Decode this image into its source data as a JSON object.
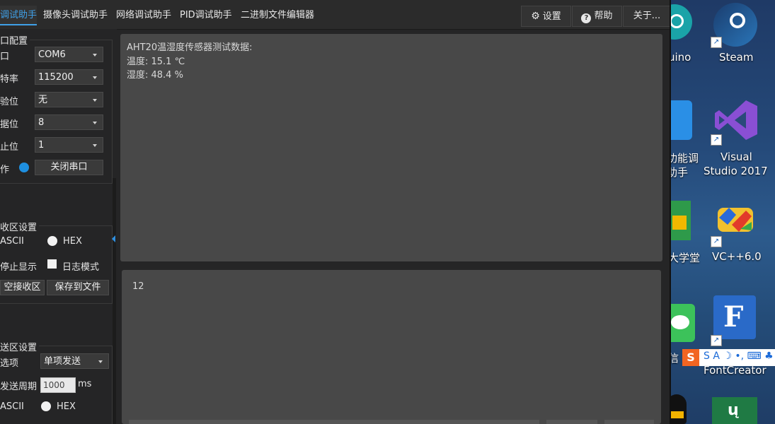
{
  "tabs": [
    "调试助手",
    "摄像头调试助手",
    "网络调试助手",
    "PID调试助手",
    "二进制文件编辑器"
  ],
  "toolbar": {
    "settings": "设置",
    "help": "帮助",
    "about": "关于..."
  },
  "serial": {
    "title": "口配置",
    "port_label": "口",
    "port_value": "COM6",
    "baud_label": "特率",
    "baud_value": "115200",
    "parity_label": "验位",
    "parity_value": "无",
    "databits_label": "据位",
    "databits_value": "8",
    "stopbits_label": "止位",
    "stopbits_value": "1",
    "op_label": "作",
    "close_button": "关闭串口"
  },
  "receive": {
    "title": "收区设置",
    "ascii": "ASCII",
    "hex": "HEX",
    "pause": "停止显示",
    "log_mode": "日志模式",
    "clear": "空接收区",
    "save": "保存到文件",
    "lines": [
      "AHT20温湿度传感器测试数据:",
      "温度: 15.1 ℃",
      "湿度: 48.4 %"
    ]
  },
  "send": {
    "title": "送区设置",
    "option_label": "选项",
    "option_value": "单项发送",
    "period_label": "发送周期",
    "period_value": "1000",
    "period_unit": "ms",
    "ascii": "ASCII",
    "hex": "HEX",
    "content": "12"
  },
  "desktop": {
    "labels": [
      "uino",
      "Steam",
      "功能调",
      "助手",
      "Visual",
      "Studio 2017",
      "大学堂",
      "VC++6.0",
      "信",
      "FontCreator"
    ],
    "ime_text": "S A ☽ •, ⌨ ♣"
  },
  "colors": {
    "accent": "#3fa0e8",
    "panel": "#484848",
    "status_dot": "#1e8fe0"
  }
}
